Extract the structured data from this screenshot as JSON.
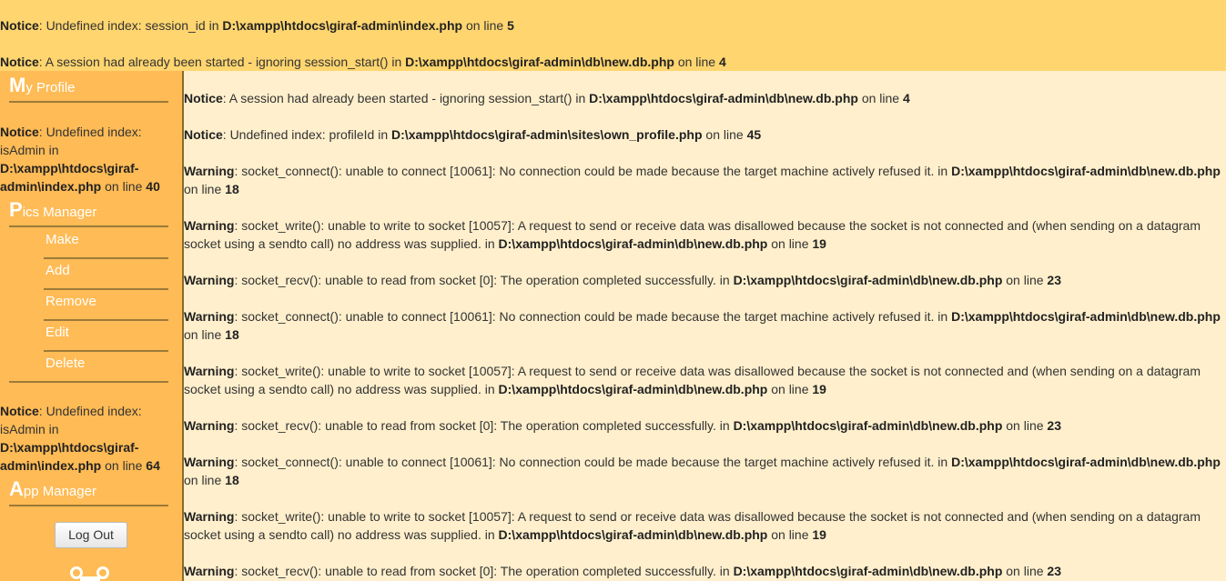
{
  "top_messages": [
    {
      "level": "Notice",
      "text": ": Undefined index: session_id in ",
      "file": "D:\\xampp\\htdocs\\giraf-admin\\index.php",
      "on": " on line ",
      "line": "5"
    },
    {
      "level": "Notice",
      "text": ": A session had already been started - ignoring session_start() in ",
      "file": "D:\\xampp\\htdocs\\giraf-admin\\db\\new.db.php",
      "on": " on line ",
      "line": "4"
    }
  ],
  "sidebar": {
    "my_profile": {
      "initial": "M",
      "rest": "y Profile"
    },
    "notice1": {
      "level": "Notice",
      "text": ": Undefined index: isAdmin in ",
      "file": "D:\\xampp\\htdocs\\giraf-admin\\index.php",
      "on": " on line ",
      "line": "40"
    },
    "pics_manager": {
      "initial": "P",
      "rest": "ics Manager"
    },
    "pics_items": [
      "Make",
      "Add",
      "Remove",
      "Edit",
      "Delete"
    ],
    "notice2": {
      "level": "Notice",
      "text": ": Undefined index: isAdmin in ",
      "file": "D:\\xampp\\htdocs\\giraf-admin\\index.php",
      "on": " on line ",
      "line": "64"
    },
    "app_manager": {
      "initial": "A",
      "rest": "pp Manager"
    },
    "logout_label": "Log Out",
    "logo_icon": "giraffe-logo-icon"
  },
  "main_messages": [
    {
      "level": "Notice",
      "text": ": A session had already been started - ignoring session_start() in ",
      "file": "D:\\xampp\\htdocs\\giraf-admin\\db\\new.db.php",
      "on": " on line ",
      "line": "4"
    },
    {
      "level": "Notice",
      "text": ": Undefined index: profileId in ",
      "file": "D:\\xampp\\htdocs\\giraf-admin\\sites\\own_profile.php",
      "on": " on line ",
      "line": "45"
    },
    {
      "level": "Warning",
      "text": ": socket_connect(): unable to connect [10061]: No connection could be made because the target machine actively refused it. in ",
      "file": "D:\\xampp\\htdocs\\giraf-admin\\db\\new.db.php",
      "on": " on line ",
      "line": "18"
    },
    {
      "level": "Warning",
      "text": ": socket_write(): unable to write to socket [10057]: A request to send or receive data was disallowed because the socket is not connected and (when sending on a datagram socket using a sendto call) no address was supplied. in ",
      "file": "D:\\xampp\\htdocs\\giraf-admin\\db\\new.db.php",
      "on": " on line ",
      "line": "19"
    },
    {
      "level": "Warning",
      "text": ": socket_recv(): unable to read from socket [0]: The operation completed successfully. in ",
      "file": "D:\\xampp\\htdocs\\giraf-admin\\db\\new.db.php",
      "on": " on line ",
      "line": "23"
    },
    {
      "level": "Warning",
      "text": ": socket_connect(): unable to connect [10061]: No connection could be made because the target machine actively refused it. in ",
      "file": "D:\\xampp\\htdocs\\giraf-admin\\db\\new.db.php",
      "on": " on line ",
      "line": "18"
    },
    {
      "level": "Warning",
      "text": ": socket_write(): unable to write to socket [10057]: A request to send or receive data was disallowed because the socket is not connected and (when sending on a datagram socket using a sendto call) no address was supplied. in ",
      "file": "D:\\xampp\\htdocs\\giraf-admin\\db\\new.db.php",
      "on": " on line ",
      "line": "19"
    },
    {
      "level": "Warning",
      "text": ": socket_recv(): unable to read from socket [0]: The operation completed successfully. in ",
      "file": "D:\\xampp\\htdocs\\giraf-admin\\db\\new.db.php",
      "on": " on line ",
      "line": "23"
    },
    {
      "level": "Warning",
      "text": ": socket_connect(): unable to connect [10061]: No connection could be made because the target machine actively refused it. in ",
      "file": "D:\\xampp\\htdocs\\giraf-admin\\db\\new.db.php",
      "on": " on line ",
      "line": "18"
    },
    {
      "level": "Warning",
      "text": ": socket_write(): unable to write to socket [10057]: A request to send or receive data was disallowed because the socket is not connected and (when sending on a datagram socket using a sendto call) no address was supplied. in ",
      "file": "D:\\xampp\\htdocs\\giraf-admin\\db\\new.db.php",
      "on": " on line ",
      "line": "19"
    },
    {
      "level": "Warning",
      "text": ": socket_recv(): unable to read from socket [0]: The operation completed successfully. in ",
      "file": "D:\\xampp\\htdocs\\giraf-admin\\db\\new.db.php",
      "on": " on line ",
      "line": "23"
    }
  ],
  "colors": {
    "top_bar": "#ffd56f",
    "sidebar": "#ffbb55",
    "content": "#ffefcc",
    "sidebar_text": "#ffffff"
  }
}
